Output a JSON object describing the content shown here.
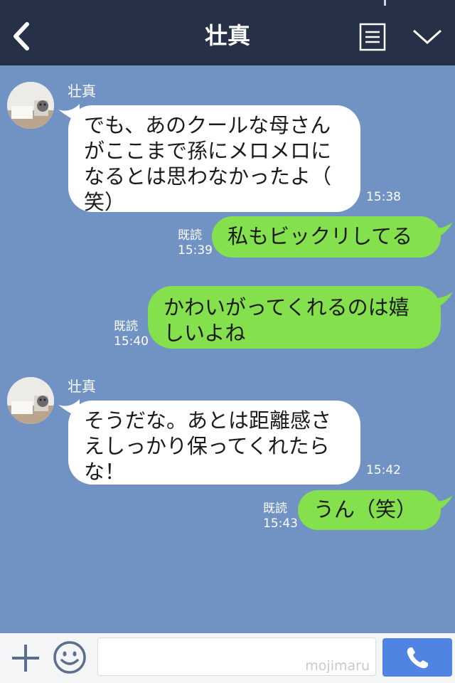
{
  "header": {
    "title": "壮真"
  },
  "messages": [
    {
      "sender": "壮真",
      "lines": [
        "でも、あのクールな母さん",
        "がここまで孫にメロメロに",
        "なるとは思わなかったよ（",
        "笑）"
      ],
      "time": "15:38"
    },
    {
      "read": "既読",
      "time": "15:39",
      "lines": [
        "私もビックリしてる"
      ]
    },
    {
      "read": "既読",
      "time": "15:40",
      "lines": [
        "かわいがってくれるのは嬉",
        "しいよね"
      ]
    },
    {
      "sender": "壮真",
      "lines": [
        "そうだな。あとは距離感さ",
        "えしっかり保ってくれたら",
        "な！"
      ],
      "time": "15:42"
    },
    {
      "read": "既読",
      "time": "15:43",
      "lines": [
        "うん（笑）"
      ]
    }
  ],
  "footer": {
    "watermark": "mojimaru"
  },
  "colors": {
    "header_bg": "#263046",
    "chat_bg": "#7193c4",
    "incoming_bubble": "#ffffff",
    "outgoing_bubble": "#84e04c",
    "call_button": "#4f84e3"
  },
  "icons": {
    "back": "chevron-left-icon",
    "menu": "menu-list-icon",
    "dropdown": "chevron-down-icon",
    "add": "plus-icon",
    "emoji": "smiley-icon",
    "call": "phone-icon"
  }
}
